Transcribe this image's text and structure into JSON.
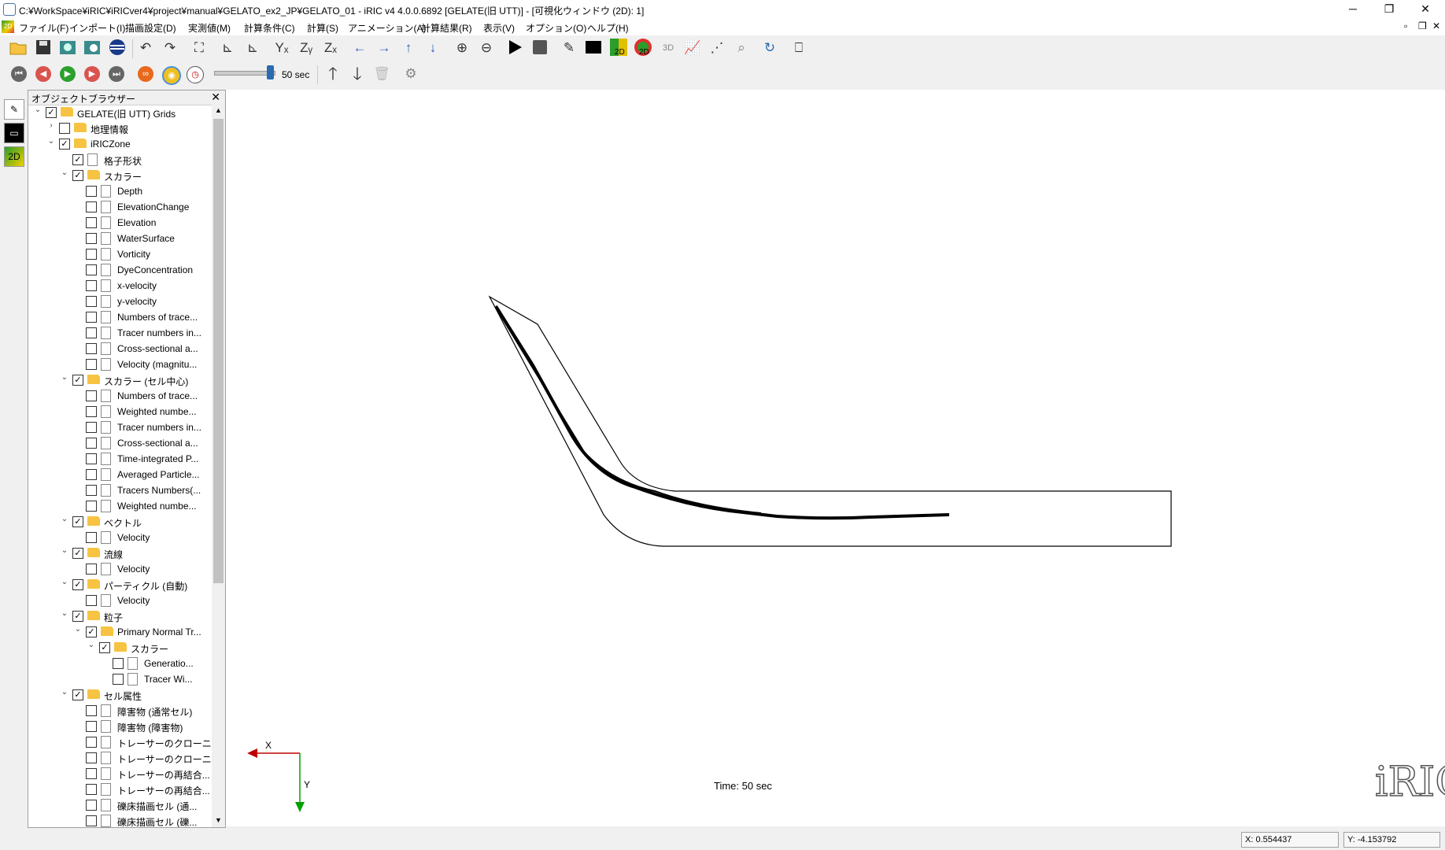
{
  "window": {
    "title": "C:¥WorkSpace¥iRIC¥iRICver4¥project¥manual¥GELATO_ex2_JP¥GELATO_01 - iRIC v4 4.0.0.6892 [GELATE(旧 UTT)] - [可視化ウィンドウ (2D): 1]",
    "minimize": "─",
    "maximize": "❐",
    "close": "✕"
  },
  "menu": [
    "ファイル(F)",
    "インポート(I)",
    "描画設定(D)",
    "実測値(M)",
    "計算条件(C)",
    "計算(S)",
    "アニメーション(A)",
    "計算結果(R)",
    "表示(V)",
    "オプション(O)",
    "ヘルプ(H)"
  ],
  "animation": {
    "slider_position": 1.0,
    "time_label": "50 sec"
  },
  "object_browser": {
    "title": "オブジェクトブラウザー",
    "close": "✕",
    "rows": [
      {
        "label": "GELATE(旧 UTT) Grids",
        "level": 0,
        "arrow": "v",
        "checked": true,
        "icon": "folder"
      },
      {
        "label": "地理情報",
        "level": 1,
        "arrow": ">",
        "checked": false,
        "icon": "folder"
      },
      {
        "label": "iRICZone",
        "level": 1,
        "arrow": "v",
        "checked": true,
        "icon": "folder"
      },
      {
        "label": "格子形状",
        "level": 2,
        "arrow": "",
        "checked": true,
        "icon": "file"
      },
      {
        "label": "スカラー",
        "level": 2,
        "arrow": "v",
        "checked": true,
        "icon": "folder"
      },
      {
        "label": "Depth",
        "level": 3,
        "arrow": "",
        "checked": false,
        "icon": "file"
      },
      {
        "label": "ElevationChange",
        "level": 3,
        "arrow": "",
        "checked": false,
        "icon": "file"
      },
      {
        "label": "Elevation",
        "level": 3,
        "arrow": "",
        "checked": false,
        "icon": "file"
      },
      {
        "label": "WaterSurface",
        "level": 3,
        "arrow": "",
        "checked": false,
        "icon": "file"
      },
      {
        "label": "Vorticity",
        "level": 3,
        "arrow": "",
        "checked": false,
        "icon": "file"
      },
      {
        "label": "DyeConcentration",
        "level": 3,
        "arrow": "",
        "checked": false,
        "icon": "file"
      },
      {
        "label": "x-velocity",
        "level": 3,
        "arrow": "",
        "checked": false,
        "icon": "file"
      },
      {
        "label": "y-velocity",
        "level": 3,
        "arrow": "",
        "checked": false,
        "icon": "file"
      },
      {
        "label": "Numbers of trace...",
        "level": 3,
        "arrow": "",
        "checked": false,
        "icon": "file"
      },
      {
        "label": "Tracer numbers in...",
        "level": 3,
        "arrow": "",
        "checked": false,
        "icon": "file"
      },
      {
        "label": "Cross-sectional a...",
        "level": 3,
        "arrow": "",
        "checked": false,
        "icon": "file"
      },
      {
        "label": "Velocity (magnitu...",
        "level": 3,
        "arrow": "",
        "checked": false,
        "icon": "file"
      },
      {
        "label": "スカラー (セル中心)",
        "level": 2,
        "arrow": "v",
        "checked": true,
        "icon": "folder"
      },
      {
        "label": "Numbers of trace...",
        "level": 3,
        "arrow": "",
        "checked": false,
        "icon": "file"
      },
      {
        "label": "Weighted numbe...",
        "level": 3,
        "arrow": "",
        "checked": false,
        "icon": "file"
      },
      {
        "label": "Tracer numbers in...",
        "level": 3,
        "arrow": "",
        "checked": false,
        "icon": "file"
      },
      {
        "label": "Cross-sectional a...",
        "level": 3,
        "arrow": "",
        "checked": false,
        "icon": "file"
      },
      {
        "label": "Time-integrated P...",
        "level": 3,
        "arrow": "",
        "checked": false,
        "icon": "file"
      },
      {
        "label": "Averaged Particle...",
        "level": 3,
        "arrow": "",
        "checked": false,
        "icon": "file"
      },
      {
        "label": "Tracers Numbers(...",
        "level": 3,
        "arrow": "",
        "checked": false,
        "icon": "file"
      },
      {
        "label": "Weighted numbe...",
        "level": 3,
        "arrow": "",
        "checked": false,
        "icon": "file"
      },
      {
        "label": "ベクトル",
        "level": 2,
        "arrow": "v",
        "checked": true,
        "icon": "folder"
      },
      {
        "label": "Velocity",
        "level": 3,
        "arrow": "",
        "checked": false,
        "icon": "file"
      },
      {
        "label": "流線",
        "level": 2,
        "arrow": "v",
        "checked": true,
        "icon": "folder"
      },
      {
        "label": "Velocity",
        "level": 3,
        "arrow": "",
        "checked": false,
        "icon": "file"
      },
      {
        "label": "パーティクル (自動)",
        "level": 2,
        "arrow": "v",
        "checked": true,
        "icon": "folder"
      },
      {
        "label": "Velocity",
        "level": 3,
        "arrow": "",
        "checked": false,
        "icon": "file"
      },
      {
        "label": "粒子",
        "level": 2,
        "arrow": "v",
        "checked": true,
        "icon": "folder"
      },
      {
        "label": "Primary Normal Tr...",
        "level": 3,
        "arrow": "v",
        "checked": true,
        "icon": "folder"
      },
      {
        "label": "スカラー",
        "level": 4,
        "arrow": "v",
        "checked": true,
        "icon": "folder"
      },
      {
        "label": "Generatio...",
        "level": 5,
        "arrow": "",
        "checked": false,
        "icon": "file"
      },
      {
        "label": "Tracer Wi...",
        "level": 5,
        "arrow": "",
        "checked": false,
        "icon": "file"
      },
      {
        "label": "セル属性",
        "level": 2,
        "arrow": "v",
        "checked": true,
        "icon": "folder"
      },
      {
        "label": "障害物 (通常セル)",
        "level": 3,
        "arrow": "",
        "checked": false,
        "icon": "file"
      },
      {
        "label": "障害物 (障害物)",
        "level": 3,
        "arrow": "",
        "checked": false,
        "icon": "file"
      },
      {
        "label": "トレーサーのクローニ...",
        "level": 3,
        "arrow": "",
        "checked": false,
        "icon": "file"
      },
      {
        "label": "トレーサーのクローニ...",
        "level": 3,
        "arrow": "",
        "checked": false,
        "icon": "file"
      },
      {
        "label": "トレーサーの再結合...",
        "level": 3,
        "arrow": "",
        "checked": false,
        "icon": "file"
      },
      {
        "label": "トレーサーの再結合...",
        "level": 3,
        "arrow": "",
        "checked": false,
        "icon": "file"
      },
      {
        "label": "礫床描画セル (通...",
        "level": 3,
        "arrow": "",
        "checked": false,
        "icon": "file"
      },
      {
        "label": "礫床描画セル (礫...",
        "level": 3,
        "arrow": "",
        "checked": false,
        "icon": "file"
      }
    ]
  },
  "canvas": {
    "axis_x": "X",
    "axis_y": "Y",
    "time_text": "Time: 50 sec",
    "logo": "iRIC"
  },
  "status": {
    "x": "X: 0.554437",
    "y": "Y: -4.153792"
  },
  "colors": {
    "axis_x": "#c00000",
    "axis_y": "#00a000",
    "folder": "#f6c342",
    "play_green": "#2ca02c",
    "nav_red": "#d9534f"
  }
}
